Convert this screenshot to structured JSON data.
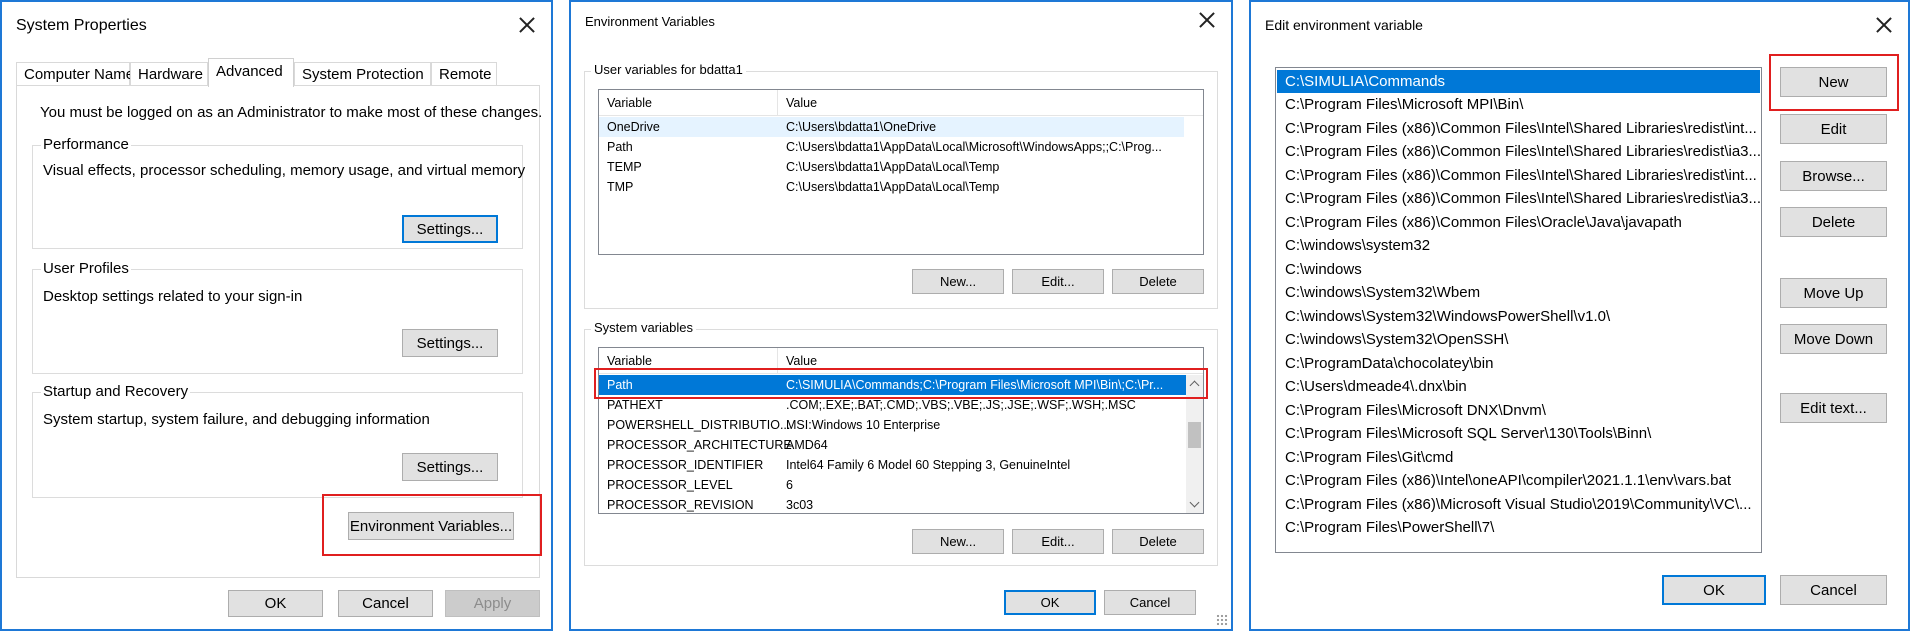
{
  "system_properties": {
    "title": "System Properties",
    "tabs": [
      "Computer Name",
      "Hardware",
      "Advanced",
      "System Protection",
      "Remote"
    ],
    "admin_notice": "You must be logged on as an Administrator to make most of these changes.",
    "performance": {
      "label": "Performance",
      "description": "Visual effects, processor scheduling, memory usage, and virtual memory",
      "button": "Settings..."
    },
    "user_profiles": {
      "label": "User Profiles",
      "description": "Desktop settings related to your sign-in",
      "button": "Settings..."
    },
    "startup": {
      "label": "Startup and Recovery",
      "description": "System startup, system failure, and debugging information",
      "button": "Settings..."
    },
    "env_button": "Environment Variables...",
    "ok": "OK",
    "cancel": "Cancel",
    "apply": "Apply"
  },
  "environment_variables": {
    "title": "Environment Variables",
    "user_section": "User variables for bdatta1",
    "columns": [
      "Variable",
      "Value"
    ],
    "user_rows": [
      {
        "variable": "OneDrive",
        "value": "C:\\Users\\bdatta1\\OneDrive"
      },
      {
        "variable": "Path",
        "value": "C:\\Users\\bdatta1\\AppData\\Local\\Microsoft\\WindowsApps;;C:\\Prog..."
      },
      {
        "variable": "TEMP",
        "value": "C:\\Users\\bdatta1\\AppData\\Local\\Temp"
      },
      {
        "variable": "TMP",
        "value": "C:\\Users\\bdatta1\\AppData\\Local\\Temp"
      }
    ],
    "system_section": "System variables",
    "system_rows": [
      {
        "variable": "Path",
        "value": "C:\\SIMULIA\\Commands;C:\\Program Files\\Microsoft MPI\\Bin\\;C:\\Pr..."
      },
      {
        "variable": "PATHEXT",
        "value": ".COM;.EXE;.BAT;.CMD;.VBS;.VBE;.JS;.JSE;.WSF;.WSH;.MSC"
      },
      {
        "variable": "POWERSHELL_DISTRIBUTIO...",
        "value": "MSI:Windows 10 Enterprise"
      },
      {
        "variable": "PROCESSOR_ARCHITECTURE",
        "value": "AMD64"
      },
      {
        "variable": "PROCESSOR_IDENTIFIER",
        "value": "Intel64 Family 6 Model 60 Stepping 3, GenuineIntel"
      },
      {
        "variable": "PROCESSOR_LEVEL",
        "value": "6"
      },
      {
        "variable": "PROCESSOR_REVISION",
        "value": "3c03"
      }
    ],
    "user_buttons": {
      "new": "New...",
      "edit": "Edit...",
      "delete": "Delete"
    },
    "system_buttons": {
      "new": "New...",
      "edit": "Edit...",
      "delete": "Delete"
    },
    "ok": "OK",
    "cancel": "Cancel"
  },
  "edit_env_var": {
    "title": "Edit environment variable",
    "paths": [
      "C:\\SIMULIA\\Commands",
      "C:\\Program Files\\Microsoft MPI\\Bin\\",
      "C:\\Program Files (x86)\\Common Files\\Intel\\Shared Libraries\\redist\\int...",
      "C:\\Program Files (x86)\\Common Files\\Intel\\Shared Libraries\\redist\\ia3...",
      "C:\\Program Files (x86)\\Common Files\\Intel\\Shared Libraries\\redist\\int...",
      "C:\\Program Files (x86)\\Common Files\\Intel\\Shared Libraries\\redist\\ia3...",
      "C:\\Program Files (x86)\\Common Files\\Oracle\\Java\\javapath",
      "C:\\windows\\system32",
      "C:\\windows",
      "C:\\windows\\System32\\Wbem",
      "C:\\windows\\System32\\WindowsPowerShell\\v1.0\\",
      "C:\\windows\\System32\\OpenSSH\\",
      "C:\\ProgramData\\chocolatey\\bin",
      "C:\\Users\\dmeade4\\.dnx\\bin",
      "C:\\Program Files\\Microsoft DNX\\Dnvm\\",
      "C:\\Program Files\\Microsoft SQL Server\\130\\Tools\\Binn\\",
      "C:\\Program Files\\Git\\cmd",
      "C:\\Program Files (x86)\\Intel\\oneAPI\\compiler\\2021.1.1\\env\\vars.bat",
      "C:\\Program Files (x86)\\Microsoft Visual Studio\\2019\\Community\\VC\\...",
      "C:\\Program Files\\PowerShell\\7\\"
    ],
    "buttons": {
      "new": "New",
      "edit": "Edit",
      "browse": "Browse...",
      "delete": "Delete",
      "move_up": "Move Up",
      "move_down": "Move Down",
      "edit_text": "Edit text..."
    },
    "ok": "OK",
    "cancel": "Cancel"
  },
  "colors": {
    "accent": "#0078d7",
    "highlight_box": "#e01f1f",
    "window_border": "#1e78d6"
  }
}
